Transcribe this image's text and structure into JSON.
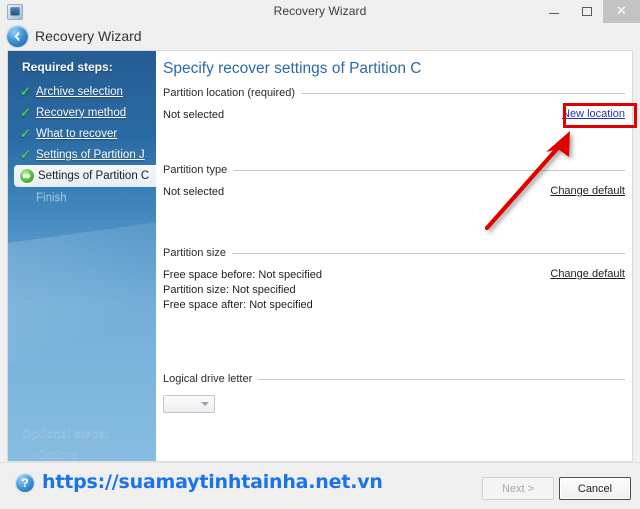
{
  "window": {
    "title": "Recovery Wizard",
    "app_icon": "app-window-icon",
    "minimize_label": "Minimize",
    "maximize_label": "Maximize",
    "close_label": "Close"
  },
  "header": {
    "back_icon": "back-arrow-icon",
    "title": "Recovery Wizard"
  },
  "sidebar": {
    "title": "Required steps:",
    "items": [
      {
        "label": "Archive selection",
        "state": "done"
      },
      {
        "label": "Recovery method",
        "state": "done"
      },
      {
        "label": "What to recover",
        "state": "done"
      },
      {
        "label": "Settings of Partition J",
        "state": "done"
      },
      {
        "label": "Settings of Partition C",
        "state": "active"
      },
      {
        "label": "Finish",
        "state": "pending"
      }
    ],
    "optional_title": "Optional steps:",
    "optional_items": [
      {
        "label": "Options"
      }
    ]
  },
  "content": {
    "page_title": "Specify recover settings of Partition C",
    "sections": [
      {
        "label": "Partition location (required)",
        "value": "Not selected",
        "link": "New location",
        "link_style": "blue",
        "highlighted": true
      },
      {
        "label": "Partition type",
        "value": "Not selected",
        "link": "Change default",
        "link_style": "plain",
        "highlighted": false
      },
      {
        "label": "Partition size",
        "lines": [
          "Free space before: Not specified",
          "Partition size: Not specified",
          "Free space after: Not specified"
        ],
        "link": "Change default",
        "link_style": "plain",
        "highlighted": false
      },
      {
        "label": "Logical drive letter",
        "select_value": "",
        "select_icon": "chevron-down-icon",
        "highlighted": false
      }
    ]
  },
  "footer": {
    "help_icon": "help-question-icon",
    "watermark": "https://suamaytinhtainha.net.vn",
    "next_label": "Next >",
    "next_enabled": false,
    "cancel_label": "Cancel",
    "cancel_enabled": true
  },
  "annotation": {
    "box_target": "New location",
    "color": "#e00000",
    "arrow": "points-to-new-location-link"
  },
  "colors": {
    "accent_blue": "#2b6ba5",
    "link_blue": "#2233bb",
    "annotation_red": "#e00000",
    "watermark_blue": "#1a73e8",
    "check_green": "#3fd13f"
  }
}
